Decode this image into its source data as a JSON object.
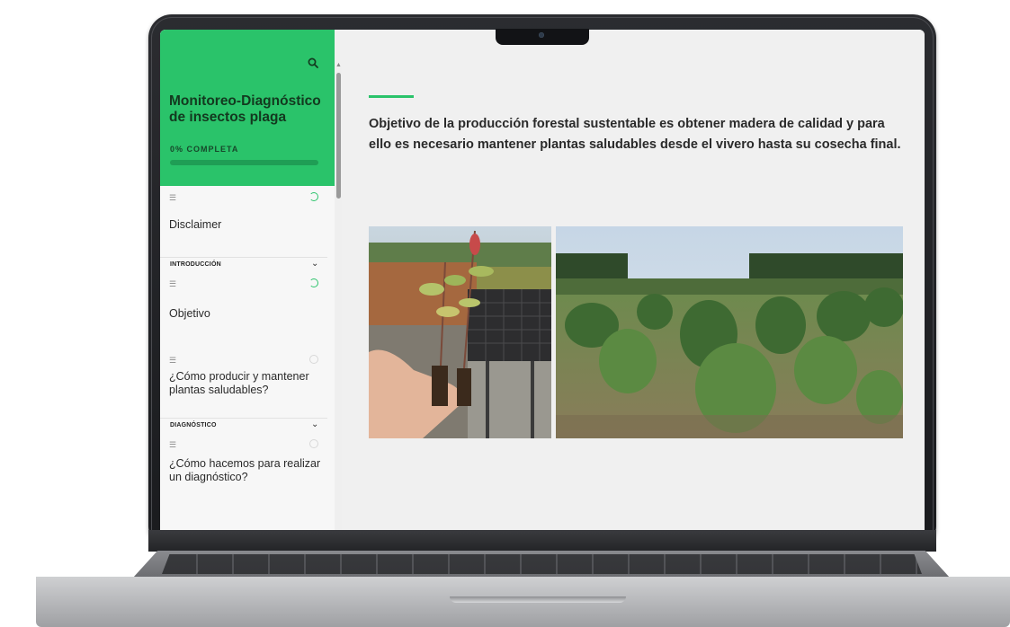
{
  "course": {
    "title": "Monitoreo-Diagnóstico de insectos plaga",
    "progress_label": "0% COMPLETA",
    "progress": 0
  },
  "sidebar": {
    "search_icon": "search-icon",
    "lessons": [
      {
        "label": "Disclaimer",
        "status": "in-progress"
      },
      {
        "section": "INTRODUCCIÓN"
      },
      {
        "label": "Objetivo",
        "status": "in-progress"
      },
      {
        "label": "¿Cómo producir y mantener plantas saludables?",
        "status": "not-started"
      },
      {
        "section": "DIAGNÓSTICO"
      },
      {
        "label": "¿Cómo hacemos para realizar un diagnóstico?",
        "status": "not-started"
      }
    ]
  },
  "main": {
    "objective": "Objetivo de la producción forestal sustentable es obtener madera de calidad y para ello es necesario mantener plantas saludables desde el vivero hasta su cosecha final."
  },
  "colors": {
    "accent": "#2ac36a",
    "header_bg": "#2ac36a"
  }
}
